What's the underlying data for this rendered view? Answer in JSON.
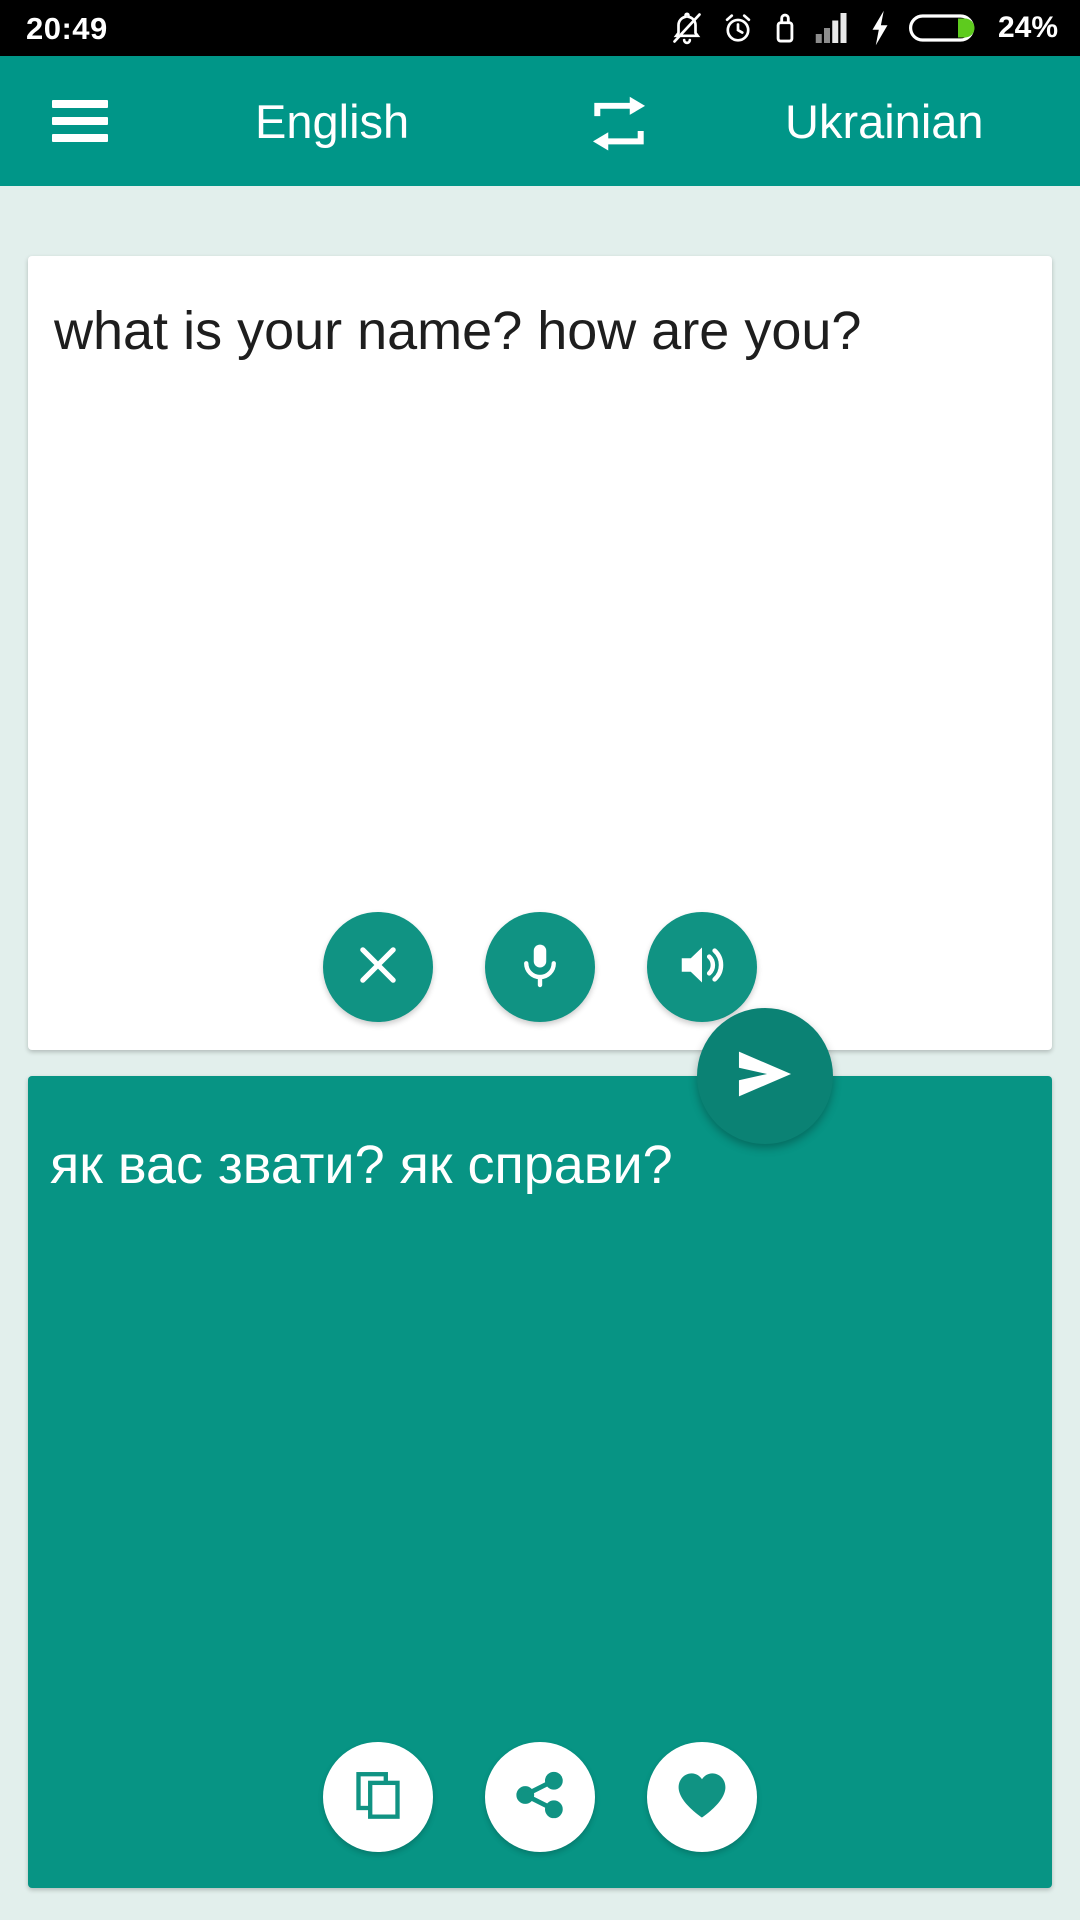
{
  "status_bar": {
    "time": "20:49",
    "battery_percent": "24%",
    "icons": [
      "bell-off-icon",
      "alarm-clock-icon",
      "usb-icon",
      "signal-bars-icon",
      "charging-bolt-icon",
      "battery-icon"
    ]
  },
  "app_bar": {
    "menu_icon": "hamburger-menu-icon",
    "source_language": "English",
    "swap_icon": "swap-languages-icon",
    "target_language": "Ukrainian"
  },
  "source_panel": {
    "text": "what is your name? how are you?",
    "placeholder": "",
    "actions": [
      {
        "name": "clear-button",
        "icon": "close-icon"
      },
      {
        "name": "microphone-button",
        "icon": "microphone-icon"
      },
      {
        "name": "speak-source-button",
        "icon": "speaker-icon"
      }
    ]
  },
  "send_button": {
    "name": "translate-send-button",
    "icon": "send-icon"
  },
  "target_panel": {
    "text": "як вас звати? як справи?",
    "actions": [
      {
        "name": "copy-button",
        "icon": "copy-icon"
      },
      {
        "name": "share-button",
        "icon": "share-icon"
      },
      {
        "name": "favorite-button",
        "icon": "heart-icon"
      }
    ]
  },
  "colors": {
    "accent": "#009688",
    "accent_dark": "#0b8274",
    "target_card": "#079484",
    "page_background": "#e2efec",
    "status_bar": "#000000",
    "battery_fill": "#5ecb1e"
  }
}
